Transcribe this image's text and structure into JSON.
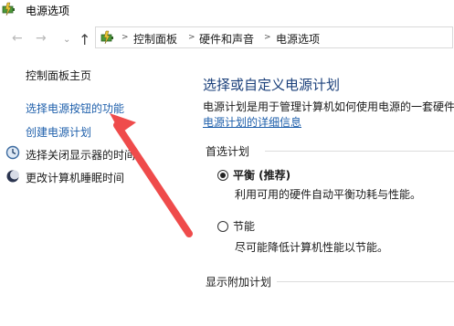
{
  "window": {
    "title": "电源选项",
    "app_icon": "power-options-icon"
  },
  "nav": {
    "back_icon": "back-arrow-icon",
    "forward_icon": "forward-arrow-icon",
    "recent_icon": "chevron-down-icon",
    "up_icon": "up-arrow-icon"
  },
  "breadcrumb": {
    "items": [
      "控制面板",
      "硬件和声音",
      "电源选项"
    ],
    "separator": ">"
  },
  "sidebar": {
    "home": "控制面板主页",
    "items": [
      {
        "label": "选择电源按钮的功能",
        "icon": ""
      },
      {
        "label": "创建电源计划",
        "icon": ""
      },
      {
        "label": "选择关闭显示器的时间",
        "icon": "display-clock-icon"
      },
      {
        "label": "更改计算机睡眠时间",
        "icon": "moon-icon"
      }
    ]
  },
  "main": {
    "heading": "选择或自定义电源计划",
    "intro": "电源计划是用于管理计算机如何使用电源的一套硬件",
    "details_link": "电源计划的详细信息",
    "preferred_group": "首选计划",
    "plans": [
      {
        "name": "平衡 (推荐)",
        "description": "利用可用的硬件自动平衡功耗与性能。",
        "selected": true
      },
      {
        "name": "节能",
        "description": "尽可能降低计算机性能以节能。",
        "selected": false
      }
    ],
    "additional_group": "显示附加计划"
  },
  "annotation": {
    "color": "#ef4b4b",
    "shape": "arrow"
  }
}
